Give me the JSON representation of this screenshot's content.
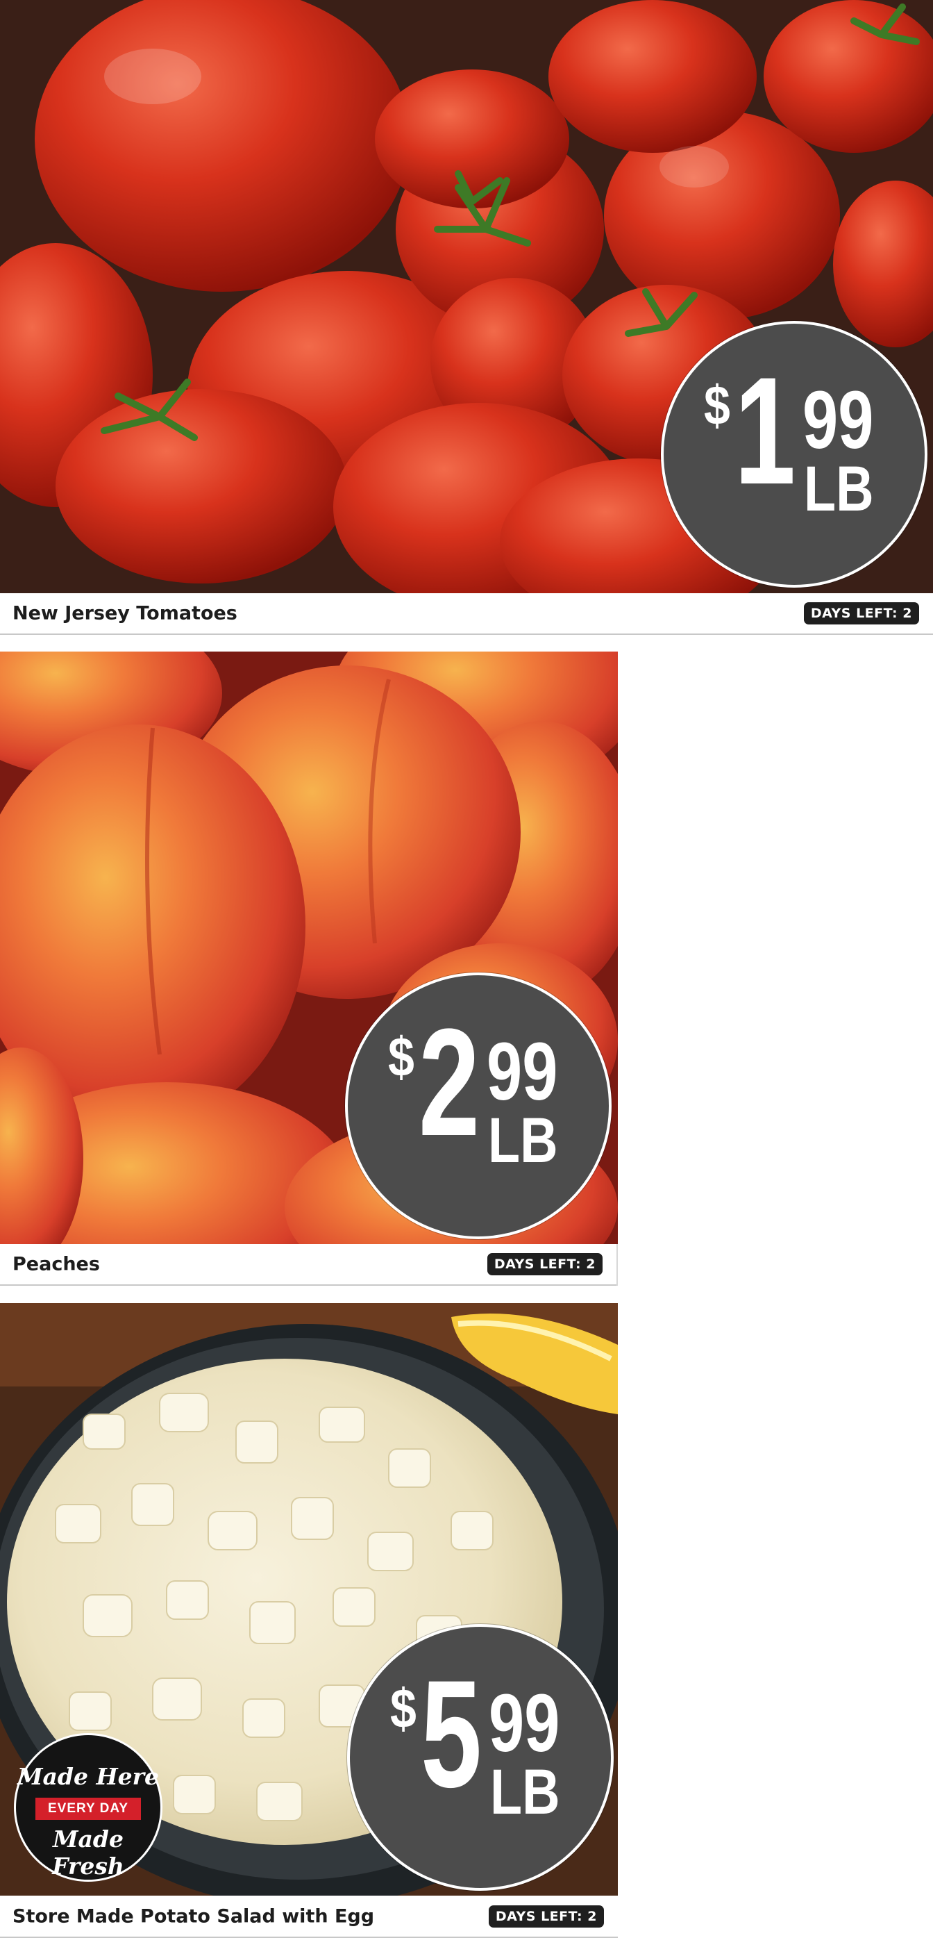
{
  "products": [
    {
      "name": "New Jersey Tomatoes",
      "days_left": "DAYS LEFT: 2",
      "price": {
        "currency": "$",
        "dollars": "1",
        "cents": "99",
        "unit": "LB"
      },
      "image": "tomatoes-photo"
    },
    {
      "name": "Peaches",
      "days_left": "DAYS LEFT: 2",
      "price": {
        "currency": "$",
        "dollars": "2",
        "cents": "99",
        "unit": "LB"
      },
      "image": "peaches-photo"
    },
    {
      "name": "Store Made Potato Salad with Egg",
      "days_left": "DAYS LEFT: 2",
      "price": {
        "currency": "$",
        "dollars": "5",
        "cents": "99",
        "unit": "LB"
      },
      "image": "potato-salad-photo",
      "badge": {
        "line1": "Made Here",
        "ribbon": "EVERY DAY",
        "line2": "Made Fresh"
      }
    }
  ],
  "colors": {
    "price_circle": "#4c4c4c",
    "days_badge": "#1f1f1f",
    "ribbon": "#d4202a"
  }
}
